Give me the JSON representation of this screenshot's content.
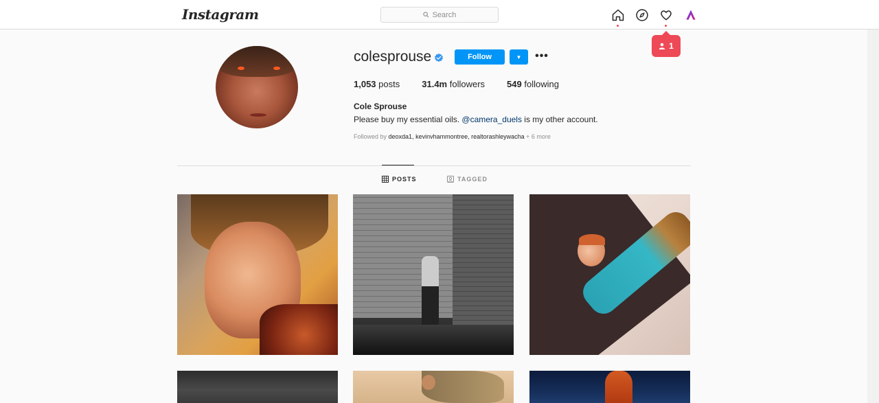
{
  "app": {
    "logo_text": "Instagram",
    "search_placeholder": "Search",
    "notification_count": "1",
    "colors": {
      "accent": "#0095f6",
      "notification": "#ed4956",
      "verified": "#3897f0"
    },
    "nav_icons": [
      "home-icon",
      "explore-icon",
      "heart-icon",
      "profile-avatar-icon"
    ]
  },
  "profile": {
    "username": "colesprouse",
    "verified": true,
    "follow_label": "Follow",
    "stats": {
      "posts_count": "1,053",
      "posts_label": "posts",
      "followers_count": "31.4m",
      "followers_label": "followers",
      "following_count": "549",
      "following_label": "following"
    },
    "full_name": "Cole Sprouse",
    "bio_before": "Please buy my essential oils. ",
    "bio_mention": "@camera_duels",
    "bio_after": " is my other account.",
    "followed_by_prefix": "Followed by ",
    "followed_by_names": "deoxda1, kevinvhammontree, realtorashleywacha",
    "followed_by_more": " + 6 more"
  },
  "tabs": {
    "posts_label": "POSTS",
    "tagged_label": "TAGGED",
    "active": "posts"
  }
}
